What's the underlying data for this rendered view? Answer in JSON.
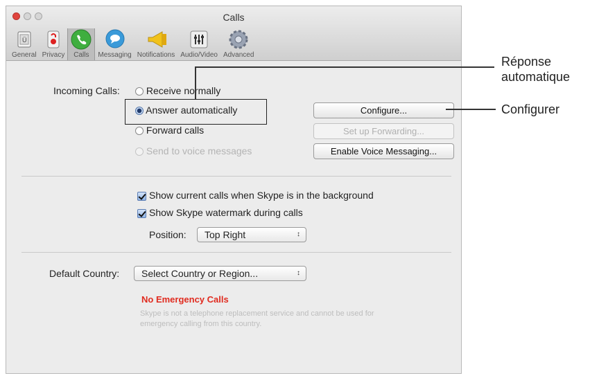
{
  "window": {
    "title": "Calls"
  },
  "toolbar": {
    "items": [
      {
        "label": "General",
        "icon": "general-icon"
      },
      {
        "label": "Privacy",
        "icon": "privacy-icon"
      },
      {
        "label": "Calls",
        "icon": "calls-icon"
      },
      {
        "label": "Messaging",
        "icon": "messaging-icon"
      },
      {
        "label": "Notifications",
        "icon": "notifications-icon"
      },
      {
        "label": "Audio/Video",
        "icon": "audio-video-icon"
      },
      {
        "label": "Advanced",
        "icon": "advanced-icon"
      }
    ],
    "selected": "Calls"
  },
  "incoming": {
    "label": "Incoming Calls:",
    "options": {
      "receive_normally": "Receive normally",
      "answer_automatically": "Answer automatically",
      "forward_calls": "Forward calls",
      "voice_messages": "Send to voice messages"
    },
    "selected": "Answer automatically"
  },
  "buttons": {
    "configure": "Configure...",
    "set_up_forwarding": "Set up Forwarding...",
    "enable_voice_messaging": "Enable Voice Messaging..."
  },
  "display": {
    "show_calls_background": "Show current calls when Skype is in the background",
    "show_watermark": "Show Skype watermark during calls",
    "position_label": "Position:",
    "position_value": "Top Right"
  },
  "country": {
    "label": "Default Country:",
    "value": "Select Country or Region...",
    "no_emergency_title": "No Emergency Calls",
    "no_emergency_text_line1": "Skype is not a telephone replacement service and cannot be used for",
    "no_emergency_text_line2": "emergency calling from this country."
  },
  "callouts": {
    "reponse_line1": "Réponse",
    "reponse_line2": "automatique",
    "configurer": "Configurer"
  },
  "colors": {
    "emergency_red": "#e02b1f",
    "close_button": "#e0443e"
  }
}
